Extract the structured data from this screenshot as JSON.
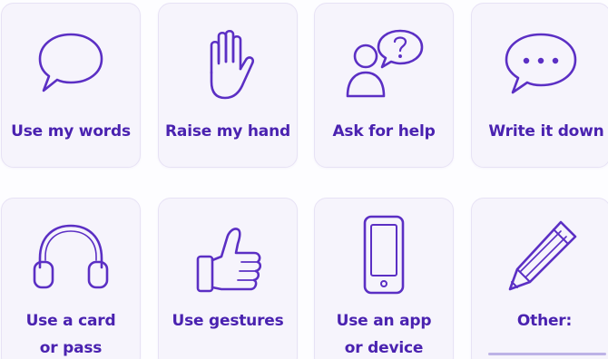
{
  "colors": {
    "accent": "#5b2fc4",
    "card_bg": "#f6f4fc",
    "card_border": "#e7e2f5"
  },
  "cards": [
    {
      "label": "Use my words",
      "icon": "speech-bubble-icon"
    },
    {
      "label": "Raise my hand",
      "icon": "raised-hand-icon"
    },
    {
      "label": "Ask for help",
      "icon": "person-question-icon"
    },
    {
      "label": "Write it down",
      "icon": "ellipsis-bubble-icon"
    },
    {
      "label_line1": "Use a card",
      "label_line2": "or pass",
      "icon": "headphones-icon"
    },
    {
      "label": "Use gestures",
      "icon": "thumbs-up-icon"
    },
    {
      "label_line1": "Use an app",
      "label_line2": "or device",
      "icon": "tablet-icon"
    },
    {
      "label": "Other:",
      "icon": "pencil-icon"
    }
  ]
}
